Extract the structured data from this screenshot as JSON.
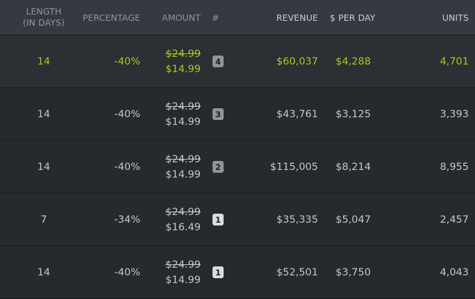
{
  "header": {
    "length_line1": "LENGTH",
    "length_line2": "(IN DAYS)",
    "percentage": "PERCENTAGE",
    "amount": "AMOUNT",
    "rank": "#",
    "revenue": "REVENUE",
    "per_day": "$ PER DAY",
    "units": "UNITS"
  },
  "rows": [
    {
      "length": "14",
      "percentage": "-40%",
      "old_price": "$24.99",
      "new_price": "$14.99",
      "rank": "4",
      "revenue": "$60,037",
      "per_day": "$4,288",
      "units": "4,701",
      "highlighted": true
    },
    {
      "length": "14",
      "percentage": "-40%",
      "old_price": "$24.99",
      "new_price": "$14.99",
      "rank": "3",
      "revenue": "$43,761",
      "per_day": "$3,125",
      "units": "3,393",
      "highlighted": false
    },
    {
      "length": "14",
      "percentage": "-40%",
      "old_price": "$24.99",
      "new_price": "$14.99",
      "rank": "2",
      "revenue": "$115,005",
      "per_day": "$8,214",
      "units": "8,955",
      "highlighted": false
    },
    {
      "length": "7",
      "percentage": "-34%",
      "old_price": "$24.99",
      "new_price": "$16.49",
      "rank": "1",
      "revenue": "$35,335",
      "per_day": "$5,047",
      "units": "2,457",
      "highlighted": false
    },
    {
      "length": "14",
      "percentage": "-40%",
      "old_price": "$24.99",
      "new_price": "$14.99",
      "rank": "1",
      "revenue": "$52,501",
      "per_day": "$3,750",
      "units": "4,043",
      "highlighted": false
    }
  ],
  "colors": {
    "highlight_text": "#a4cc22",
    "header_bg": "#363a40",
    "row_bg": "#26292e",
    "highlight_bg": "#2c2f33"
  }
}
